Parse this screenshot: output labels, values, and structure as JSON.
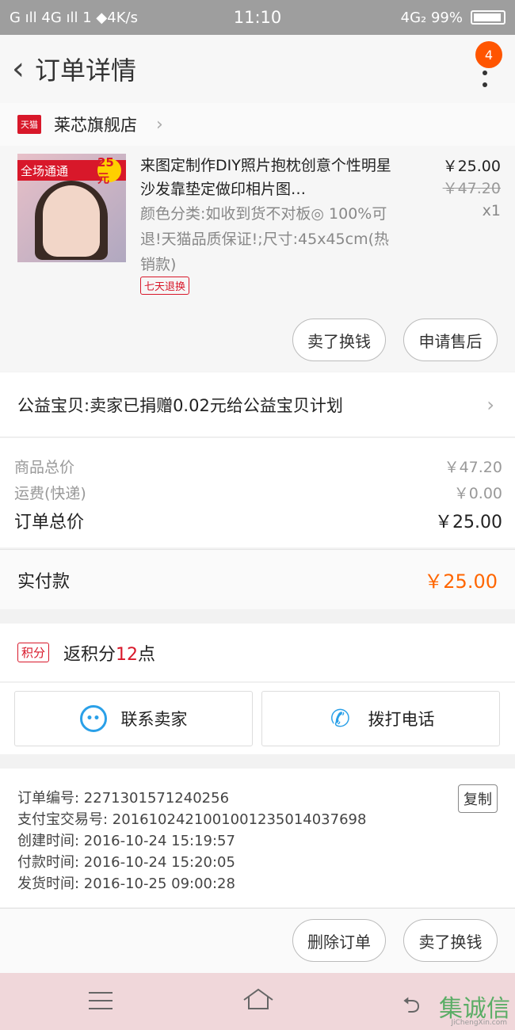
{
  "status_bar": {
    "left": "G ıll 4G ıll 1 ◆4K/s",
    "time": "11:10",
    "right": "4G₂ 99%"
  },
  "header": {
    "title": "订单详情",
    "badge": "4"
  },
  "shop": {
    "badge": "天猫",
    "name": "莱芯旗舰店"
  },
  "item": {
    "thumb_banner": "全场通通",
    "thumb_price": "25元",
    "title": "来图定制作DIY照片抱枕创意个性明星沙发靠垫定做印相片图…",
    "sku": "颜色分类:如收到货不对板◎ 100%可退!天猫品质保证!;尺寸:45x45cm(热销款)",
    "tag": "七天退换",
    "price_now": "￥25.00",
    "price_old": "￥47.20",
    "qty": "x1",
    "btn_sell": "卖了换钱",
    "btn_aftersale": "申请售后"
  },
  "charity": {
    "text": "公益宝贝:卖家已捐赠0.02元给公益宝贝计划"
  },
  "summary": {
    "goods_label": "商品总价",
    "goods_value": "￥47.20",
    "ship_label": "运费(快递)",
    "ship_value": "￥0.00",
    "total_label": "订单总价",
    "total_value": "￥25.00"
  },
  "paid": {
    "label": "实付款",
    "value": "￥25.00"
  },
  "points": {
    "tag": "积分",
    "prefix": "返积分",
    "num": "12",
    "suffix": "点"
  },
  "contact": {
    "seller": "联系卖家",
    "phone": "拨打电话"
  },
  "order_info": {
    "copy": "复制",
    "rows": [
      "订单编号: 2271301571240256",
      "支付宝交易号: 2016102421001001235014037698",
      "创建时间: 2016-10-24 15:19:57",
      "付款时间: 2016-10-24 15:20:05",
      "发货时间: 2016-10-25 09:00:28"
    ]
  },
  "actions": {
    "delete": "删除订单",
    "sell": "卖了换钱"
  },
  "watermark": {
    "text": "集诚信",
    "sub": "JiChengXin.com"
  }
}
